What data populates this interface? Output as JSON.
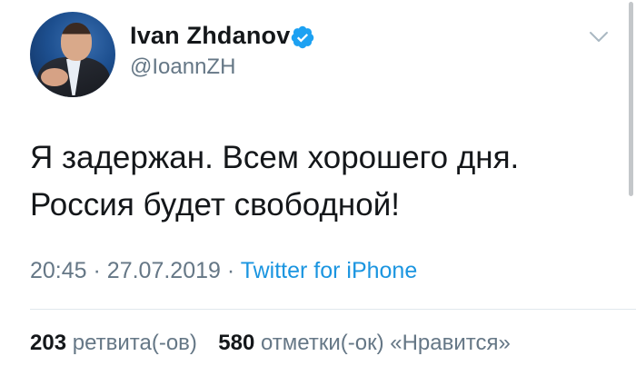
{
  "author": {
    "name": "Ivan Zhdanov",
    "handle": "@IoannZH",
    "verified": true
  },
  "tweet": {
    "line1": "Я задержан. Всем хорошего дня.",
    "line2": "Россия будет свободной!"
  },
  "meta": {
    "time": "20:45",
    "separator": "·",
    "date": "27.07.2019",
    "source": "Twitter for iPhone"
  },
  "stats": {
    "retweets_count": "203",
    "retweets_label": "ретвита(-ов)",
    "likes_count": "580",
    "likes_label": "отметки(-ок) «Нравится»"
  },
  "icons": {
    "verified": "verified-badge-icon",
    "menu": "chevron-down-icon"
  },
  "colors": {
    "verified": "#1da1f2",
    "link": "#1b95e0",
    "secondary_text": "#657786"
  }
}
